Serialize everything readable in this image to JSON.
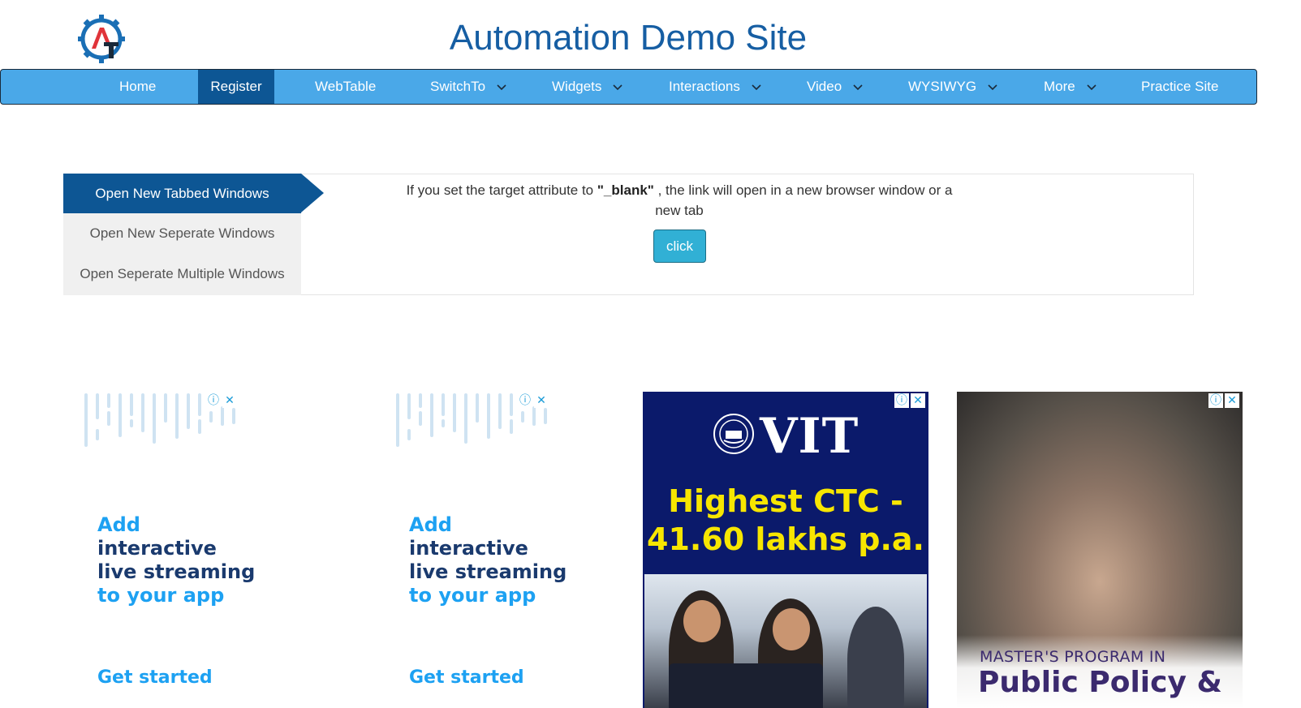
{
  "header": {
    "title": "Automation Demo Site",
    "logo_letters": "AT"
  },
  "nav": {
    "items": [
      {
        "label": "Home",
        "dropdown": false,
        "active": false
      },
      {
        "label": "Register",
        "dropdown": false,
        "active": true
      },
      {
        "label": "WebTable",
        "dropdown": false,
        "active": false
      },
      {
        "label": "SwitchTo",
        "dropdown": true,
        "active": false
      },
      {
        "label": "Widgets",
        "dropdown": true,
        "active": false
      },
      {
        "label": "Interactions",
        "dropdown": true,
        "active": false
      },
      {
        "label": "Video",
        "dropdown": true,
        "active": false
      },
      {
        "label": "WYSIWYG",
        "dropdown": true,
        "active": false
      },
      {
        "label": "More",
        "dropdown": true,
        "active": false
      },
      {
        "label": "Practice Site",
        "dropdown": false,
        "active": false
      }
    ]
  },
  "tabs": {
    "items": [
      {
        "label": "Open New Tabbed Windows",
        "active": true
      },
      {
        "label": "Open New Seperate Windows",
        "active": false
      },
      {
        "label": "Open Seperate Multiple Windows",
        "active": false
      }
    ],
    "content": {
      "text_before": "If you set the target attribute to ",
      "text_bold": "\"_blank\"",
      "text_after": " , the link will open in a new browser window or a new tab",
      "button_label": "click"
    }
  },
  "ads": {
    "info_icon": "ⓘ",
    "close_icon": "✕",
    "streaming": {
      "line1": "Add",
      "line2": "interactive",
      "line3": "live streaming",
      "line4": "to your app",
      "cta": "Get started"
    },
    "vit": {
      "brand": "VIT",
      "tag_line1": "Highest CTC -",
      "tag_line2": "41.60 lakhs p.a."
    },
    "policy": {
      "subtitle": "MASTER'S PROGRAM IN",
      "title": "Public Policy &"
    }
  },
  "colors": {
    "brand_blue": "#165ea3",
    "nav_bg": "#4aa8e8",
    "nav_active": "#0d5694",
    "button": "#31b0d5"
  }
}
